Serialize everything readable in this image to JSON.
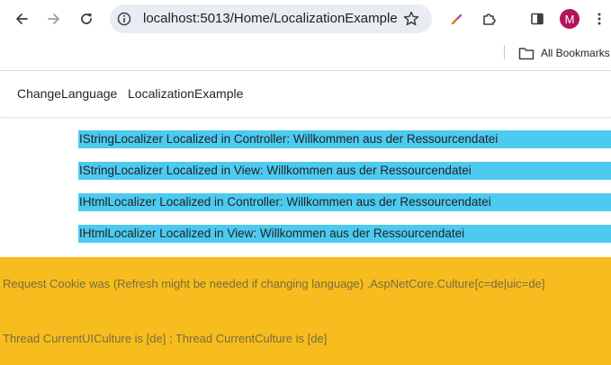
{
  "browser": {
    "url": "localhost:5013/Home/LocalizationExample",
    "avatar_initial": "M",
    "bookmarks_label": "All Bookmarks",
    "colors": {
      "avatar": "#b3125d",
      "omnibox": "#e9edf3"
    }
  },
  "nav": {
    "items": [
      {
        "label": "ChangeLanguage"
      },
      {
        "label": "LocalizationExample"
      }
    ]
  },
  "localized_lines": [
    "IStringLocalizer Localized in Controller: Willkommen aus der Ressourcendatei",
    "IStringLocalizer Localized in View: Willkommen aus der Ressourcendatei",
    "IHtmlLocalizer Localized in Controller: Willkommen aus der Ressourcendatei",
    "IHtmlLocalizer Localized in View: Willkommen aus der Ressourcendatei"
  ],
  "info_panel": {
    "cookie_text": "Request Cookie was (Refresh might be needed if changing language) .AspNetCore.Culture[c=de|uic=de]",
    "culture_text": "Thread CurrentUICulture is [de] ; Thread CurrentCulture is [de]"
  },
  "colors": {
    "highlight": "#4dcaf0",
    "info_background": "#f7bd1e"
  }
}
